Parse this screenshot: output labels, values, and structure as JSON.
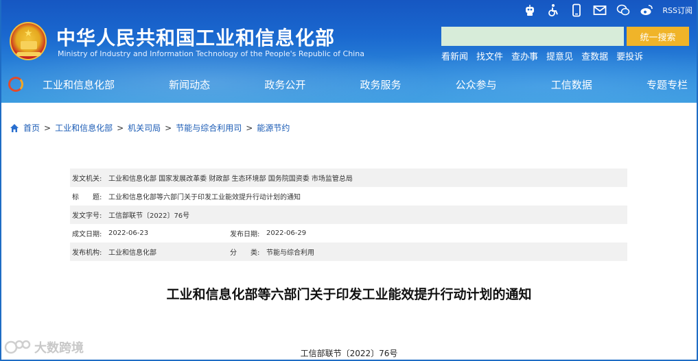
{
  "header": {
    "title": "中华人民共和国工业和信息化部",
    "subtitle": "Ministry of Industry and Information Technology of the People's Republic of China",
    "rss_label": "RSS订阅",
    "search_placeholder": "",
    "search_button": "统一搜索",
    "quick_links": [
      "看新闻",
      "找文件",
      "查办事",
      "提意见",
      "查数据",
      "要投诉"
    ],
    "icons": [
      "robot-icon",
      "accessibility-icon",
      "mobile-icon",
      "mail-icon",
      "wechat-icon",
      "weibo-icon"
    ]
  },
  "nav": {
    "items": [
      "工业和信息化部",
      "新闻动态",
      "政务公开",
      "政务服务",
      "公众参与",
      "工信数据",
      "专题专栏"
    ]
  },
  "breadcrumb": {
    "items": [
      "首页",
      "工业和信息化部",
      "机关司局",
      "节能与综合利用司",
      "能源节约"
    ],
    "separator": ">"
  },
  "meta": {
    "issuer_label": "发文机关:",
    "issuer_value": "工业和信息化部 国家发展改革委 财政部 生态环境部 国务院国资委 市场监管总局",
    "title_label": "标　　题:",
    "title_value": "工业和信息化部等六部门关于印发工业能效提升行动计划的通知",
    "docno_label": "发文字号:",
    "docno_value": "工信部联节〔2022〕76号",
    "created_label": "成文日期:",
    "created_value": "2022-06-23",
    "published_label": "发布日期:",
    "published_value": "2022-06-29",
    "org_label": "发布机构:",
    "org_value": "工业和信息化部",
    "category_label": "分　　类:",
    "category_value": "节能与综合利用"
  },
  "document": {
    "title": "工业和信息化部等六部门关于印发工业能效提升行动计划的通知",
    "number": "工信部联节〔2022〕76号"
  },
  "watermark": {
    "text": "大数跨境"
  },
  "colors": {
    "header_blue": "#1a68cf",
    "search_button": "#f0b429",
    "search_field": "#d7ecd9",
    "link_blue": "#1a5bb5",
    "meta_shade": "#f1f1f1"
  }
}
